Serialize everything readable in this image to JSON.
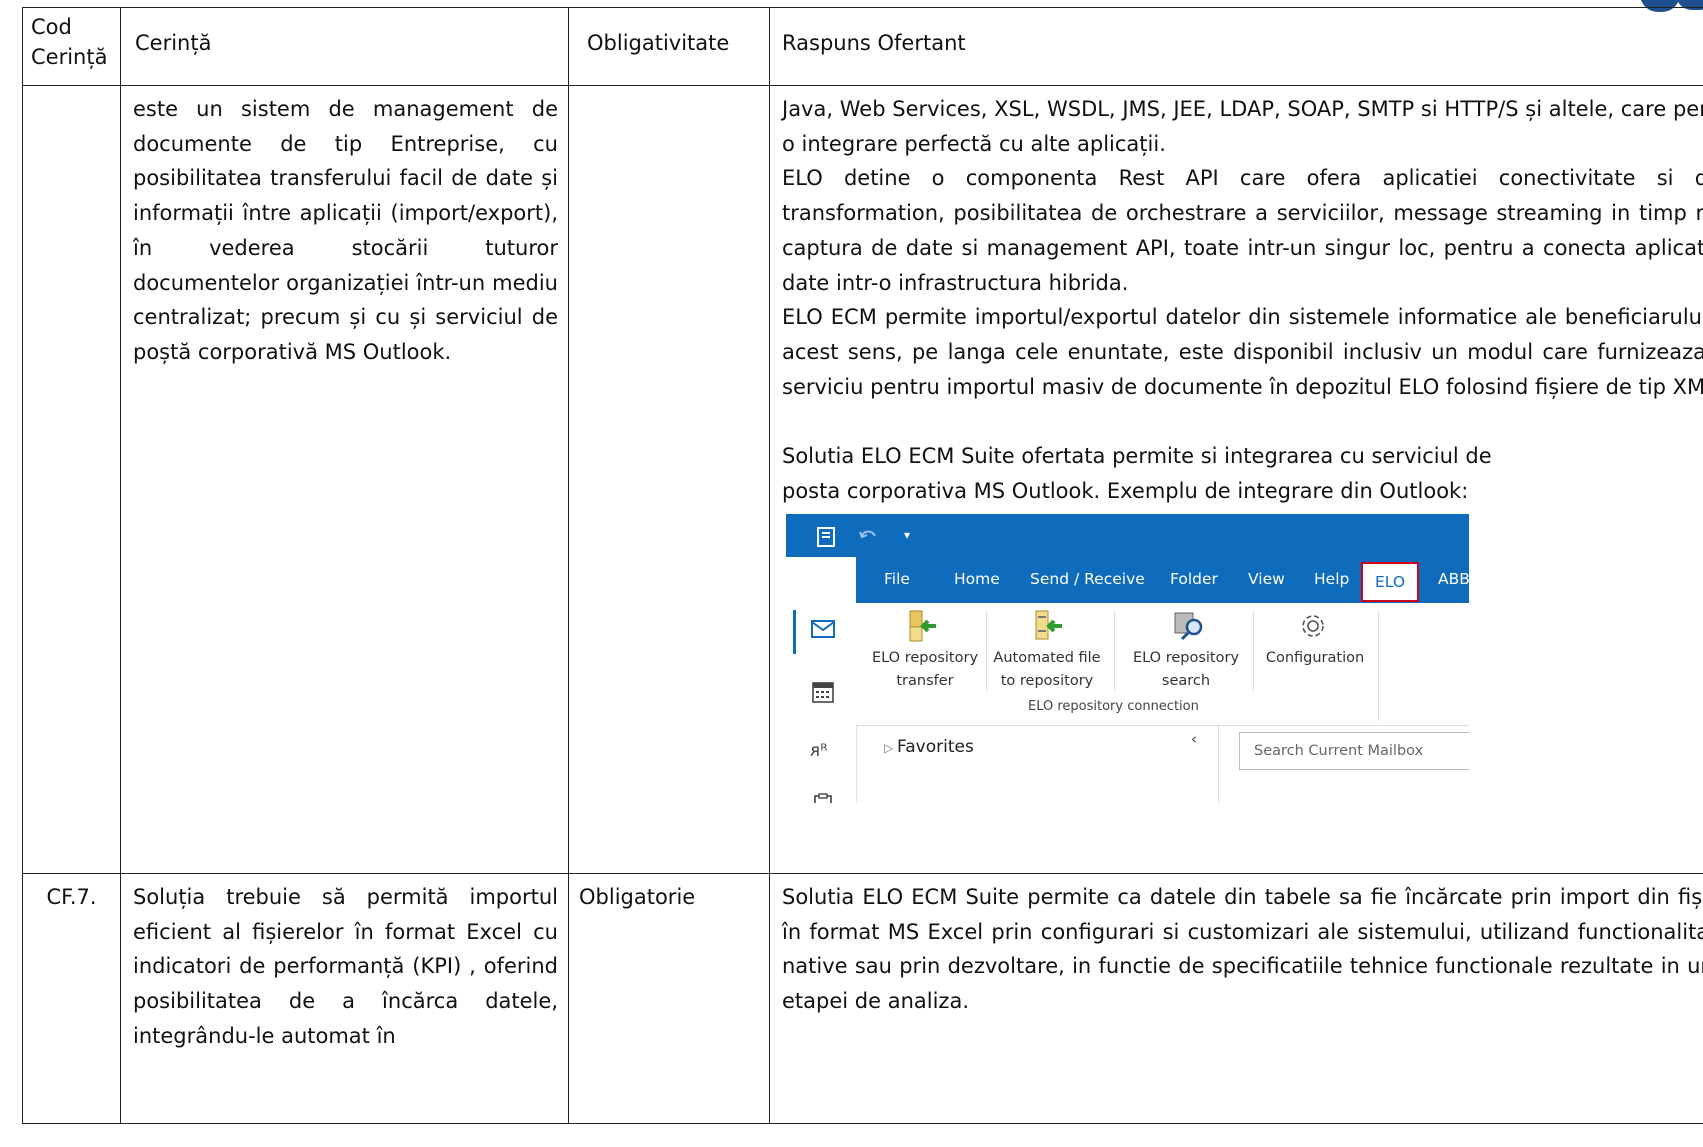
{
  "table": {
    "headers": {
      "cod": "Cod Cerință",
      "cerinta": "Cerință",
      "obligativitate": "Obligativitate",
      "raspuns": "Raspuns Ofertant"
    },
    "row1": {
      "cod": "",
      "cerinta": "este un sistem de management de documente de tip Entreprise, cu posibilitatea transferului facil de date și informații între aplicații (import/export), în vederea stocării tuturor documentelor organizației într-un mediu centralizat; precum și cu și serviciul de poștă corporativă MS Outlook.",
      "obligativitate": "",
      "raspuns_p1": "Java, Web Services, XSL, WSDL, JMS, JEE, LDAP, SOAP, SMTP si HTTP/S și altele, care permit o integrare perfectă cu alte aplicații.",
      "raspuns_p2": "ELO detine o componenta Rest API care ofera aplicatiei conectivitate si data transformation, posibilitatea de orchestrare a serviciilor, message streaming in timp real, captura de date si management API, toate intr-un singur loc, pentru a conecta aplicatii si date intr-o infrastructura hibrida.",
      "raspuns_p3": "ELO ECM permite importul/exportul datelor din sistemele informatice ale beneficiarului. In acest sens, pe langa cele enuntate, este disponibil inclusiv un modul care furnizeaza un serviciu pentru importul masiv de documente în depozitul ELO folosind fișiere de tip XML.",
      "raspuns_p4": "Solutia ELO ECM Suite ofertata permite si integrarea cu serviciul de posta corporativa MS Outlook. Exemplu de integrare din Outlook:"
    },
    "row2": {
      "cod": "CF.7.",
      "cerinta": "Soluția trebuie să permită importul eficient al fișierelor în format Excel cu indicatori de performanță (KPI) , oferind posibilitatea de a încărca datele, integrându-le automat în",
      "obligativitate": "Obligatorie",
      "raspuns": "Solutia ELO ECM Suite permite ca datele din tabele sa fie încărcate prin import din fișiere în format MS Excel prin configurari si customizari ale sistemului, utilizand functionalitatile native sau prin dezvoltare, in functie de specificatiile tehnice functionale rezultate in urma etapei de analiza."
    }
  },
  "outlook": {
    "tabs": [
      "File",
      "Home",
      "Send / Receive",
      "Folder",
      "View",
      "Help",
      "ELO",
      "ABBYY"
    ],
    "buttons": [
      {
        "line1": "ELO repository",
        "line2": "transfer",
        "icon": "repository-transfer-icon"
      },
      {
        "line1": "Automated file",
        "line2": "to repository",
        "icon": "automated-file-icon"
      },
      {
        "line1": "ELO repository",
        "line2": "search",
        "icon": "repository-search-icon"
      },
      {
        "line1": "Configuration",
        "line2": "",
        "icon": "gear-icon"
      }
    ],
    "group_label": "ELO repository connection",
    "favorites": "Favorites",
    "search_placeholder": "Search Current Mailbox",
    "colors": {
      "ribbon_blue": "#0f6cbd",
      "elo_tab_border": "#d0021b"
    }
  }
}
